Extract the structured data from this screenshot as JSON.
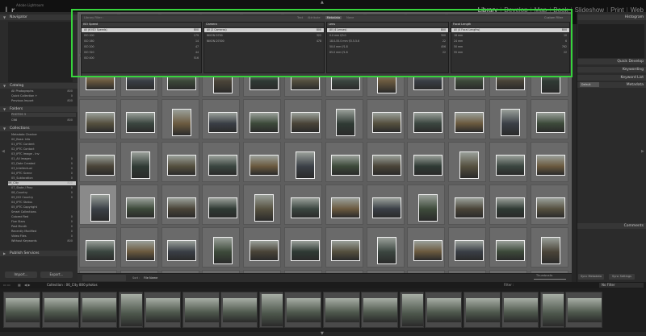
{
  "app": {
    "logo": "Lr",
    "catalog_name": "Adobe Lightroom"
  },
  "modules": [
    "Library",
    "Develop",
    "Map",
    "Book",
    "Slideshow",
    "Print",
    "Web"
  ],
  "active_module": "Library",
  "left_panel": {
    "navigator": "Navigator",
    "catalog": {
      "title": "Catalog",
      "items": [
        {
          "label": "All Photographs",
          "count": "800"
        },
        {
          "label": "Quick Collection +",
          "count": "0"
        },
        {
          "label": "Previous Import",
          "count": "800"
        }
      ]
    },
    "folders": {
      "title": "Folders",
      "volume": "PHOTOS 3",
      "folder": {
        "label": "CN6",
        "count": "800"
      }
    },
    "collections": {
      "title": "Collections",
      "items": [
        {
          "label": "Metadata Checker",
          "count": ""
        },
        {
          "label": "00_Basic Info",
          "count": ""
        },
        {
          "label": "01_IPTC Content",
          "count": ""
        },
        {
          "label": "02_IPTC Contact",
          "count": ""
        },
        {
          "label": "03_IPTC Image - Inv",
          "count": ""
        },
        {
          "label": "01_All Images",
          "count": "0"
        },
        {
          "label": "02_Date Created",
          "count": "0"
        },
        {
          "label": "03_Intellectual",
          "count": "0"
        },
        {
          "label": "04_IPTC Scene",
          "count": "0"
        },
        {
          "label": "05_Sublocation",
          "count": "0"
        },
        {
          "label": "06_City",
          "count": "800"
        },
        {
          "label": "07_State / Prov",
          "count": "0"
        },
        {
          "label": "08_Country",
          "count": "0"
        },
        {
          "label": "09_ISO Country",
          "count": "0"
        },
        {
          "label": "04_IPTC Status",
          "count": ""
        },
        {
          "label": "05_IPTC Copyright",
          "count": ""
        },
        {
          "label": "Smart Collections",
          "count": ""
        },
        {
          "label": "Colored Red",
          "count": "0"
        },
        {
          "label": "Five Stars",
          "count": "0"
        },
        {
          "label": "Past Month",
          "count": "0"
        },
        {
          "label": "Recently Modified",
          "count": "0"
        },
        {
          "label": "Video Files",
          "count": "0"
        },
        {
          "label": "Without Keywords",
          "count": "800"
        }
      ]
    },
    "publish": "Publish Services",
    "import_label": "Import...",
    "export_label": "Export..."
  },
  "filter_bar": {
    "title": "Library Filter :",
    "tabs": [
      "Text",
      "Attribute",
      "Metadata",
      "None"
    ],
    "active_tab": "Metadata",
    "preset": "Custom Filter",
    "columns": [
      {
        "title": "ISO Speed",
        "rows": [
          {
            "label": "All (6 ISO Speeds)",
            "count": "800"
          },
          {
            "label": "ISO 100",
            "count": "179"
          },
          {
            "label": "ISO 160",
            "count": "14"
          },
          {
            "label": "ISO 200",
            "count": "47"
          },
          {
            "label": "ISO 320",
            "count": "44"
          },
          {
            "label": "ISO 400",
            "count": "516"
          }
        ]
      },
      {
        "title": "Camera",
        "rows": [
          {
            "label": "All (2 Cameras)",
            "count": "800"
          },
          {
            "label": "NIKON D700",
            "count": "322"
          },
          {
            "label": "NIKON D7000",
            "count": "478"
          }
        ]
      },
      {
        "title": "Lens",
        "rows": [
          {
            "label": "All (4 Lenses)",
            "count": "800"
          },
          {
            "label": "0.0 mm f/0.0",
            "count": "300"
          },
          {
            "label": "18.0-55.0 mm f/3.5-5.6",
            "count": "22"
          },
          {
            "label": "50.0 mm f/1.8",
            "count": "456"
          },
          {
            "label": "85.0 mm f/1.8",
            "count": "22"
          }
        ]
      },
      {
        "title": "Focal Length",
        "rows": [
          {
            "label": "All (4 Focal Lengths)",
            "count": "800"
          },
          {
            "label": "18 mm",
            "count": "10"
          },
          {
            "label": "24 mm",
            "count": "6"
          },
          {
            "label": "50 mm",
            "count": "762"
          },
          {
            "label": "55 mm",
            "count": "22"
          }
        ]
      }
    ]
  },
  "right_panel": {
    "histogram": "Histogram",
    "quick_develop": "Quick Develop",
    "keywording": "Keywording",
    "keyword_list": "Keyword List",
    "metadata_preset": "Default",
    "metadata": "Metadata",
    "comments": "Comments",
    "sync_metadata": "Sync Metadata",
    "sync_settings": "Sync Settings"
  },
  "toolbar": {
    "sort_label": "Sort :",
    "sort_value": "File Name",
    "thumbnails_label": "Thumbnails"
  },
  "filmstrip": {
    "path": "Collection : 06_City",
    "photo_count": "800 photos",
    "filter_label": "Filter :",
    "filter_value": "No Filter"
  }
}
